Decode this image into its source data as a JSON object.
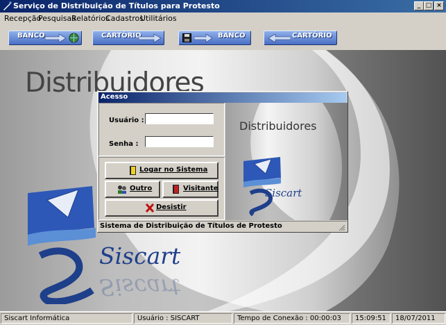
{
  "window": {
    "title": "Serviço de Distribuição de Títulos para Protesto",
    "min_glyph": "_",
    "max_glyph": "□",
    "close_glyph": "×"
  },
  "menu": [
    "Recepção",
    "Pesquisas",
    "Relatórios",
    "Cadastros",
    "Utilitários"
  ],
  "toolbar": {
    "btn1": "BANCO",
    "btn2": "CARTÓRIO",
    "btn3": "BANCO",
    "btn4": "CARTÓRIO"
  },
  "background": {
    "heading": "Distribuidores",
    "brand": "Siscart"
  },
  "dialog": {
    "title": "Acesso",
    "usuario_label": "Usuário :",
    "senha_label": "Senha :",
    "usuario_value": "",
    "senha_value": "",
    "login_button": "Logar no Sistema",
    "outro_button": "Outro",
    "visitante_button": "Visitante",
    "desistir_button": "Desistir",
    "image_heading": "Distribuidores",
    "image_brand": "Siscart",
    "status": "Sistema de Distribuição de Títulos de Protesto"
  },
  "statusbar": {
    "company": "Siscart Informática",
    "user": "Usuário : SISCART",
    "connection": "Tempo de Conexão : 00:00:03",
    "time": "15:09:51",
    "date": "18/07/2011"
  },
  "colors": {
    "titlebar": "#0a246a",
    "accent_blue": "#4a6fc4",
    "brand_blue": "#1e3f8a"
  }
}
